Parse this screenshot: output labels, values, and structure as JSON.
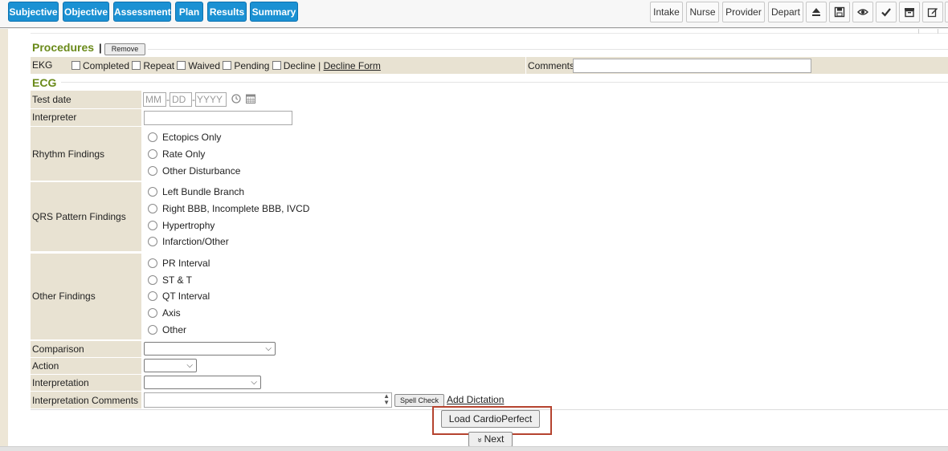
{
  "toolbar": {
    "tabs": [
      "Subjective",
      "Objective",
      "Assessment",
      "Plan",
      "Results",
      "Summary"
    ],
    "right_buttons": [
      "Intake",
      "Nurse",
      "Provider",
      "Depart"
    ],
    "icons": [
      "eject-icon",
      "save-icon",
      "eye-icon",
      "check-icon",
      "archive-icon",
      "edit-icon"
    ]
  },
  "procedures": {
    "title": "Procedures",
    "separator": "|",
    "remove_label": "Remove",
    "ekg_label": "EKG",
    "checks": [
      "Completed",
      "Repeat",
      "Waived",
      "Pending",
      "Decline"
    ],
    "pipe": "|",
    "decline_form_label": "Decline Form",
    "comments_label": "Comments"
  },
  "ecg": {
    "title": "ECG",
    "test_date_label": "Test date",
    "date_placeholders": {
      "mm": "MM",
      "dd": "DD",
      "yyyy": "YYYY"
    },
    "date_sep": "-",
    "interpreter_label": "Interpreter",
    "rhythm_label": "Rhythm Findings",
    "rhythm_options": [
      "Ectopics Only",
      "Rate Only",
      "Other Disturbance"
    ],
    "qrs_label": "QRS Pattern Findings",
    "qrs_options": [
      "Left Bundle Branch",
      "Right BBB, Incomplete BBB, IVCD",
      "Hypertrophy",
      "Infarction/Other"
    ],
    "other_label": "Other Findings",
    "other_options": [
      "PR Interval",
      "ST & T",
      "QT Interval",
      "Axis",
      "Other"
    ],
    "comparison_label": "Comparison",
    "action_label": "Action",
    "interpretation_label": "Interpretation",
    "interp_comments_label": "Interpretation Comments",
    "spell_check_label": "Spell Check",
    "add_dictation_label": "Add Dictation"
  },
  "footer": {
    "load_label": "Load CardioPerfect",
    "next_label": "Next",
    "next_icon": "double-chevron-down-icon"
  },
  "colors": {
    "tab_blue": "#1b91d3",
    "section_green": "#6a8a1a",
    "label_beige": "#e8e2d2",
    "highlight_red": "#b5432f"
  }
}
